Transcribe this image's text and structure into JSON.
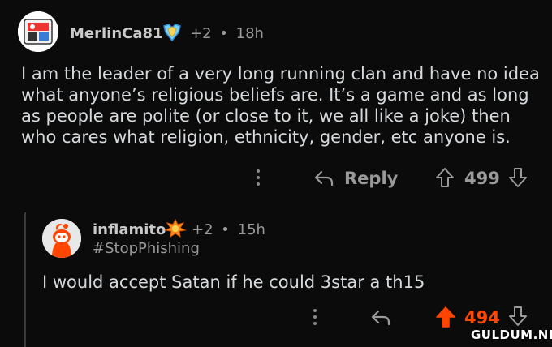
{
  "comment_top": {
    "username": "MerlinCa81",
    "award_extra": "+2",
    "separator": "•",
    "age": "18h",
    "body": "I am the leader of a very long running clan and have no idea what anyone’s religious beliefs are.  It’s a game and as long as people are polite (or close to it, we all like a joke) then who cares what religion, ethnicity, gender, etc anyone is.",
    "reply_label": "Reply",
    "score": "499"
  },
  "comment_reply": {
    "username": "inflamito",
    "award_extra": "+2",
    "separator": "•",
    "age": "15h",
    "flair": "#StopPhishing",
    "body": "I would accept Satan if he could 3star a th15",
    "score": "494"
  },
  "watermark": "GULDUM.NET",
  "colors": {
    "background": "#0b0b0b",
    "text": "#d7dadc",
    "muted": "#9a9a9a",
    "upvoted": "#ff4500"
  },
  "icons": [
    "avatar",
    "award-icon",
    "more-options-icon",
    "reply-icon",
    "upvote-icon",
    "downvote-icon"
  ]
}
